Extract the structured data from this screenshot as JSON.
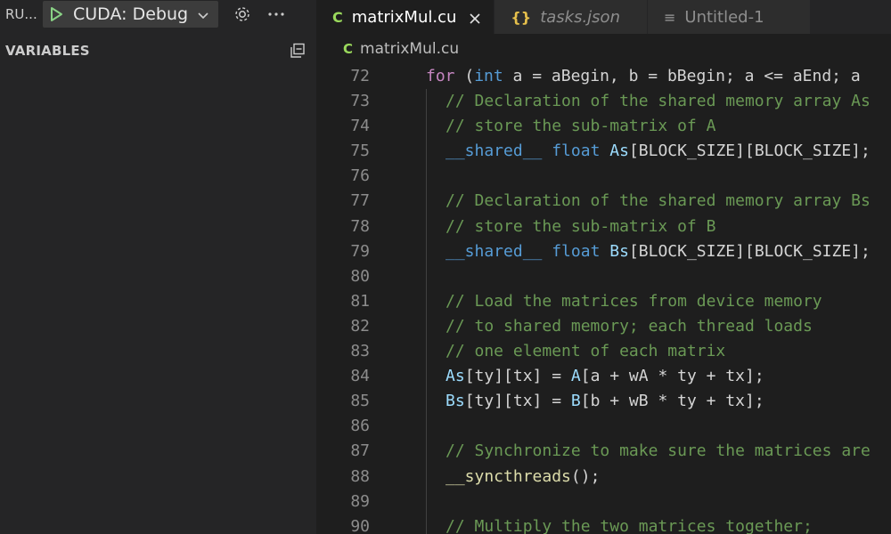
{
  "colors": {
    "accent_green": "#89d185",
    "file_cu_icon": "#9ad95c",
    "json_icon": "#e6c04c"
  },
  "sidebar": {
    "run_label": "RU...",
    "config_name": "CUDA: Debug",
    "variables_title": "VARIABLES",
    "icons": [
      "play-icon",
      "chevron-down-icon",
      "gear-icon",
      "more-icon",
      "collapse-all-icon"
    ]
  },
  "editor": {
    "tabs": [
      {
        "label": "matrixMul.cu",
        "icon": "C",
        "active": true
      },
      {
        "label": "tasks.json",
        "icon": "{}",
        "active": false
      },
      {
        "label": "Untitled-1",
        "icon": "≡",
        "active": false
      }
    ],
    "breadcrumb": {
      "icon": "C",
      "label": "matrixMul.cu"
    },
    "lines": [
      {
        "n": "72",
        "t": [
          [
            "kw",
            "for"
          ],
          [
            "pn",
            " ("
          ],
          [
            "ty",
            "int"
          ],
          [
            "pn",
            " a = aBegin, b = bBegin; a <= aEnd; a"
          ]
        ],
        "lvl": 0
      },
      {
        "n": "73",
        "t": [
          [
            "cm",
            "// Declaration of the shared memory array As"
          ]
        ],
        "lvl": 1
      },
      {
        "n": "74",
        "t": [
          [
            "cm",
            "// store the sub-matrix of A"
          ]
        ],
        "lvl": 1
      },
      {
        "n": "75",
        "t": [
          [
            "ty",
            "__shared__"
          ],
          [
            "pn",
            " "
          ],
          [
            "ty",
            "float"
          ],
          [
            "pn",
            " "
          ],
          [
            "id",
            "As"
          ],
          [
            "pn",
            "[BLOCK_SIZE][BLOCK_SIZE];"
          ]
        ],
        "lvl": 1
      },
      {
        "n": "76",
        "t": [],
        "lvl": 1
      },
      {
        "n": "77",
        "t": [
          [
            "cm",
            "// Declaration of the shared memory array Bs"
          ]
        ],
        "lvl": 1
      },
      {
        "n": "78",
        "t": [
          [
            "cm",
            "// store the sub-matrix of B"
          ]
        ],
        "lvl": 1
      },
      {
        "n": "79",
        "t": [
          [
            "ty",
            "__shared__"
          ],
          [
            "pn",
            " "
          ],
          [
            "ty",
            "float"
          ],
          [
            "pn",
            " "
          ],
          [
            "id",
            "Bs"
          ],
          [
            "pn",
            "[BLOCK_SIZE][BLOCK_SIZE];"
          ]
        ],
        "lvl": 1
      },
      {
        "n": "80",
        "t": [],
        "lvl": 1
      },
      {
        "n": "81",
        "t": [
          [
            "cm",
            "// Load the matrices from device memory"
          ]
        ],
        "lvl": 1
      },
      {
        "n": "82",
        "t": [
          [
            "cm",
            "// to shared memory; each thread loads"
          ]
        ],
        "lvl": 1
      },
      {
        "n": "83",
        "t": [
          [
            "cm",
            "// one element of each matrix"
          ]
        ],
        "lvl": 1
      },
      {
        "n": "84",
        "t": [
          [
            "id",
            "As"
          ],
          [
            "pn",
            "[ty][tx] = "
          ],
          [
            "id",
            "A"
          ],
          [
            "pn",
            "[a + wA * ty + tx];"
          ]
        ],
        "lvl": 1
      },
      {
        "n": "85",
        "t": [
          [
            "id",
            "Bs"
          ],
          [
            "pn",
            "[ty][tx] = "
          ],
          [
            "id",
            "B"
          ],
          [
            "pn",
            "[b + wB * ty + tx];"
          ]
        ],
        "lvl": 1
      },
      {
        "n": "86",
        "t": [],
        "lvl": 1
      },
      {
        "n": "87",
        "t": [
          [
            "cm",
            "// Synchronize to make sure the matrices are"
          ]
        ],
        "lvl": 1
      },
      {
        "n": "88",
        "t": [
          [
            "fn",
            "__syncthreads"
          ],
          [
            "pn",
            "();"
          ]
        ],
        "lvl": 1
      },
      {
        "n": "89",
        "t": [],
        "lvl": 1
      },
      {
        "n": "90",
        "t": [
          [
            "cm",
            "// Multiply the two matrices together;"
          ]
        ],
        "lvl": 1
      }
    ]
  }
}
